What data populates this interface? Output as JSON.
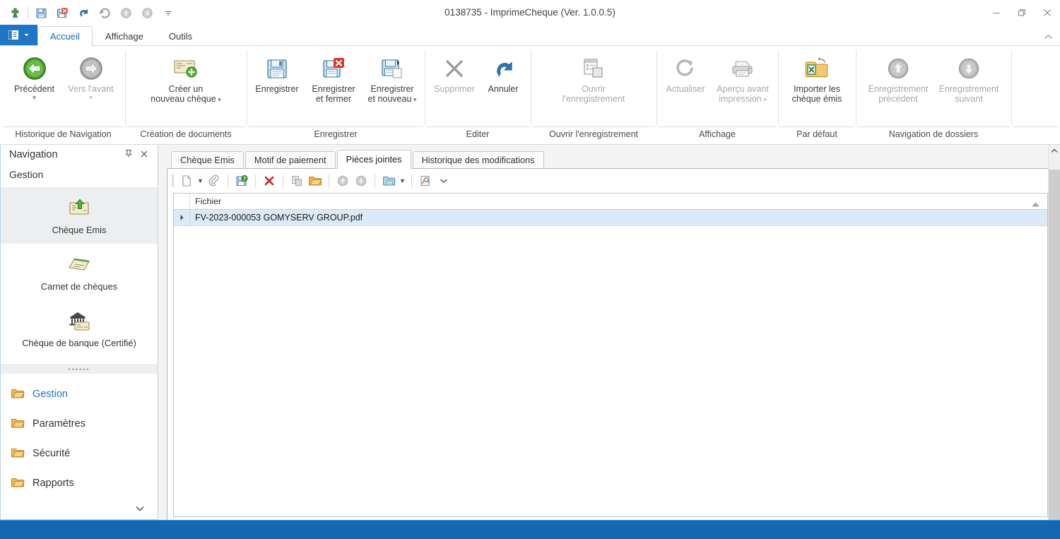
{
  "window": {
    "title": "0138735 - ImprimeCheque (Ver. 1.0.0.5)",
    "minimize": "minimize-icon",
    "restore": "restore-icon",
    "close": "close-icon"
  },
  "quick_access": {
    "items": [
      {
        "name": "new-record-icon",
        "label": "Nouveau"
      },
      {
        "name": "save-icon",
        "label": "Enregistrer"
      },
      {
        "name": "save-close-icon",
        "label": "Enregistrer et fermer"
      },
      {
        "name": "undo-icon",
        "label": "Annuler"
      },
      {
        "name": "redo-icon",
        "label": "Rétablir"
      },
      {
        "name": "previous-record-icon",
        "label": "Enregistrement précédent"
      },
      {
        "name": "next-record-icon",
        "label": "Enregistrement suivant"
      },
      {
        "name": "customize-qat-icon",
        "label": "Personnaliser"
      }
    ]
  },
  "ribbon": {
    "app_menu_label": "Menu",
    "collapse_label": "Réduire le ruban",
    "tabs": [
      {
        "label": "Accueil",
        "active": true
      },
      {
        "label": "Affichage",
        "active": false
      },
      {
        "label": "Outils",
        "active": false
      }
    ],
    "groups": [
      {
        "label": "Historique de Navigation",
        "buttons": [
          {
            "label": "Précédent",
            "icon": "back-arrow-icon",
            "disabled": false,
            "caret": true
          },
          {
            "label": "Vers l'avant",
            "icon": "forward-arrow-icon",
            "disabled": true,
            "caret": true
          }
        ]
      },
      {
        "label": "Création de documents",
        "buttons": [
          {
            "label": "Créer un\nnouveau chèque",
            "icon": "new-cheque-icon",
            "disabled": false,
            "caret": false,
            "inline_caret": true
          }
        ]
      },
      {
        "label": "Enregistrer",
        "buttons": [
          {
            "label": "Enregistrer",
            "icon": "save-icon",
            "disabled": false,
            "caret": false
          },
          {
            "label": "Enregistrer\net fermer",
            "icon": "save-close-icon",
            "disabled": false,
            "caret": false
          },
          {
            "label": "Enregistrer\net nouveau",
            "icon": "save-new-icon",
            "disabled": false,
            "caret": false,
            "inline_caret": true
          }
        ]
      },
      {
        "label": "Editer",
        "buttons": [
          {
            "label": "Supprimer",
            "icon": "delete-x-icon",
            "disabled": true,
            "caret": false
          },
          {
            "label": "Annuler",
            "icon": "undo-icon",
            "disabled": false,
            "caret": false
          }
        ]
      },
      {
        "label": "Ouvrir l'enregistrement",
        "buttons": [
          {
            "label": "Ouvrir\nl'enregistrement",
            "icon": "open-record-icon",
            "disabled": true,
            "caret": false
          }
        ]
      },
      {
        "label": "Affichage",
        "buttons": [
          {
            "label": "Actualiser",
            "icon": "refresh-icon",
            "disabled": true,
            "caret": false
          },
          {
            "label": "Aperçu avant\nimpression",
            "icon": "print-preview-icon",
            "disabled": true,
            "caret": false,
            "inline_caret": true
          }
        ]
      },
      {
        "label": "Par défaut",
        "buttons": [
          {
            "label": "Importer les\nchèque émis",
            "icon": "import-excel-icon",
            "disabled": false,
            "caret": false
          }
        ]
      },
      {
        "label": "Navigation de dossiers",
        "buttons": [
          {
            "label": "Enregistrement\nprécédent",
            "icon": "up-arrow-icon",
            "disabled": true,
            "caret": false
          },
          {
            "label": "Enregistrement\nsuivant",
            "icon": "down-arrow-icon",
            "disabled": true,
            "caret": false
          }
        ]
      }
    ]
  },
  "navigation": {
    "title": "Navigation",
    "pin_icon": "pin-icon",
    "close_icon": "close-icon",
    "section_title": "Gestion",
    "big_items": [
      {
        "label": "Chèque Emis",
        "icon": "cheque-out-icon",
        "selected": true
      },
      {
        "label": "Carnet de chèques",
        "icon": "chequebook-icon",
        "selected": false
      },
      {
        "label": "Chèque de banque (Certifié)",
        "icon": "bank-cheque-icon",
        "selected": false
      },
      {
        "label": "",
        "icon": "cheque-in-icon",
        "selected": false
      }
    ],
    "overflow_caret": "chevron-down-icon",
    "splitter_dots": "••••••",
    "small_items": [
      {
        "label": "Gestion",
        "icon": "folder-icon",
        "active": true
      },
      {
        "label": "Paramètres",
        "icon": "folder-icon",
        "active": false
      },
      {
        "label": "Sécurité",
        "icon": "folder-icon",
        "active": false
      },
      {
        "label": "Rapports",
        "icon": "folder-icon",
        "active": false
      }
    ],
    "bottom_caret": "chevron-down-icon"
  },
  "document": {
    "tabs": [
      {
        "label": "Chèque Emis",
        "active": false
      },
      {
        "label": "Motif de paiement",
        "active": false
      },
      {
        "label": "Pièces jointes",
        "active": true
      },
      {
        "label": "Historique des modifications",
        "active": false
      }
    ],
    "toolbar": [
      {
        "name": "new-document-icon",
        "label": "Nouveau",
        "caret": true
      },
      {
        "name": "attach-clip-icon",
        "label": "Joindre un fichier",
        "caret": false
      },
      {
        "name": "sep",
        "label": ""
      },
      {
        "name": "save-attachment-icon",
        "label": "Enregistrer",
        "caret": false
      },
      {
        "name": "sep",
        "label": ""
      },
      {
        "name": "delete-x-icon",
        "label": "Supprimer",
        "caret": false
      },
      {
        "name": "sep",
        "label": ""
      },
      {
        "name": "copy-icon",
        "label": "Copier",
        "caret": false
      },
      {
        "name": "open-folder-icon",
        "label": "Ouvrir",
        "caret": false
      },
      {
        "name": "sep",
        "label": ""
      },
      {
        "name": "move-up-icon",
        "label": "Monter",
        "caret": false
      },
      {
        "name": "move-down-icon",
        "label": "Descendre",
        "caret": false
      },
      {
        "name": "sep",
        "label": ""
      },
      {
        "name": "save-as-icon",
        "label": "Enregistrer sous",
        "caret": true
      },
      {
        "name": "sep",
        "label": ""
      },
      {
        "name": "preview-icon",
        "label": "Aperçu",
        "caret": false
      },
      {
        "name": "overflow-chevron-icon",
        "label": "Plus d'options",
        "caret": false
      }
    ],
    "grid": {
      "columns": [
        "Fichier"
      ],
      "sort_icon": "sort-ascending-icon",
      "rows": [
        {
          "indicator": "row-pointer-icon",
          "cells": [
            "FV-2023-000053 GOMYSERV GROUP.pdf"
          ],
          "selected": true
        }
      ]
    }
  },
  "scrollbar": {
    "up_icon": "chevron-up-icon",
    "down_icon": "chevron-down-icon"
  },
  "colors": {
    "accent": "#1f76c4",
    "taskbar": "#1668b3",
    "selection": "#dceaf7",
    "nav_selected": "#eceef0"
  }
}
